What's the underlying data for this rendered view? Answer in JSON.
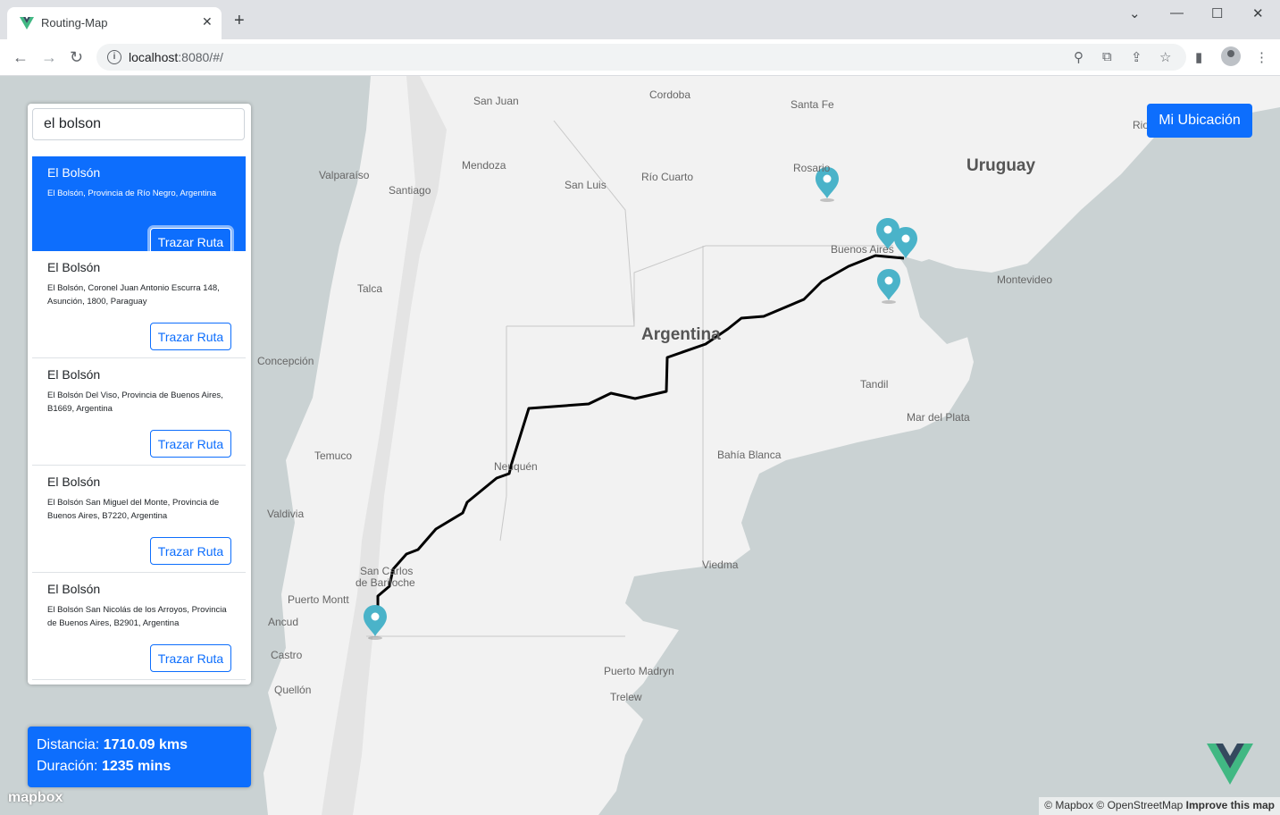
{
  "browser": {
    "tab_title": "Routing-Map",
    "url_host": "localhost",
    "url_path": ":8080/#/"
  },
  "search": {
    "query": "el bolson"
  },
  "results": [
    {
      "title": "El Bolsón",
      "address": "El Bolsón, Provincia de Río Negro, Argentina",
      "button": "Trazar Ruta"
    },
    {
      "title": "El Bolsón",
      "address": "El Bolsón, Coronel Juan Antonio Escurra 148, Asunción, 1800, Paraguay",
      "button": "Trazar Ruta"
    },
    {
      "title": "El Bolsón",
      "address": "El Bolsón Del Viso, Provincia de Buenos Aires, B1669, Argentina",
      "button": "Trazar Ruta"
    },
    {
      "title": "El Bolsón",
      "address": "El Bolsón San Miguel del Monte, Provincia de Buenos Aires, B7220, Argentina",
      "button": "Trazar Ruta"
    },
    {
      "title": "El Bolsón",
      "address": "El Bolsón San Nicolás de los Arroyos, Provincia de Buenos Aires, B2901, Argentina",
      "button": "Trazar Ruta"
    }
  ],
  "my_location_button": "Mi Ubicación",
  "stats": {
    "distance_label": "Distancia:",
    "distance_value": "1710.09 kms",
    "duration_label": "Duración:",
    "duration_value": "1235 mins"
  },
  "map": {
    "places": {
      "san_juan": "San Juan",
      "cordoba": "Cordoba",
      "santa_fe": "Santa Fe",
      "rosario": "Rosario",
      "uruguay": "Uruguay",
      "valparaiso": "Valparaíso",
      "mendoza": "Mendoza",
      "santiago": "Santiago",
      "san_luis": "San Luis",
      "rio_cuarto": "Río Cuarto",
      "buenos_aires": "Buenos Aires",
      "montevideo": "Montevideo",
      "talca": "Talca",
      "argentina": "Argentina",
      "concepcion": "Concepción",
      "tandil": "Tandil",
      "mar_del_plata": "Mar del Plata",
      "temuco": "Temuco",
      "neuquen": "Neuquén",
      "bahia_blanca": "Bahía Blanca",
      "valdivia": "Valdivia",
      "viedma": "Viedma",
      "san_carlos": "San Carlos",
      "de_bariloche": "de Bariloche",
      "puerto_montt": "Puerto Montt",
      "ancud": "Ancud",
      "castro": "Castro",
      "puerto_madryn": "Puerto Madryn",
      "trelew": "Trelew",
      "quellon": "Quellón",
      "rio": "Rio"
    },
    "attribution_text": "© Mapbox © OpenStreetMap",
    "attribution_link": "Improve this map",
    "mapbox_logo": "mapbox",
    "marker_color": "#4ab3c9",
    "route_color": "#000000",
    "accent_color": "#0d6efd"
  }
}
